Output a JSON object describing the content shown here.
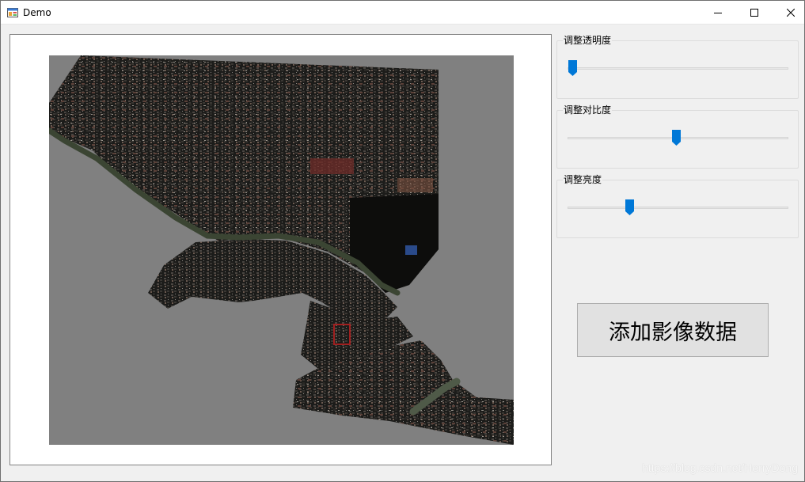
{
  "window": {
    "title": "Demo",
    "icon": "winforms-app-icon",
    "controls": [
      "minimize-icon",
      "maximize-icon",
      "close-icon"
    ]
  },
  "map": {
    "background_color": "#808080",
    "imagery": "aerial-city-imagery"
  },
  "controls": {
    "opacity": {
      "label": "调整透明度",
      "value_percent": 2
    },
    "contrast": {
      "label": "调整对比度",
      "value_percent": 49
    },
    "brightness": {
      "label": "调整亮度",
      "value_percent": 28
    }
  },
  "add_button": {
    "label": "添加影像数据"
  },
  "watermark": "https://blog.csdn.net/HerryDong",
  "colors": {
    "accent": "#0078d7",
    "button_bg": "#e1e1e1",
    "window_bg": "#f0f0f0"
  }
}
